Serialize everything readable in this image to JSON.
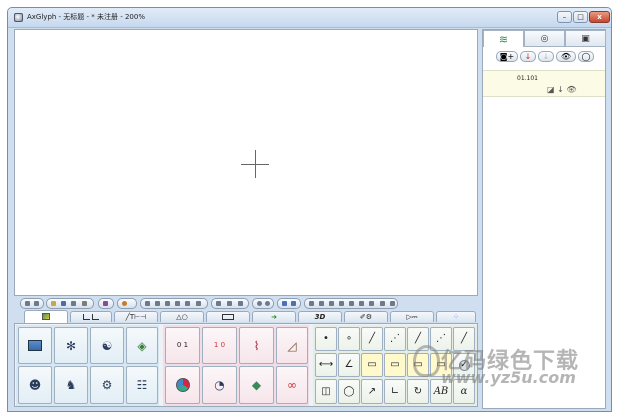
{
  "window": {
    "title": "AxGlyph - 无标题 - * 未注册 - 200%",
    "controls": {
      "minimize": "–",
      "maximize": "□",
      "close": "x"
    }
  },
  "canvas": {
    "cursor": "crosshair"
  },
  "palette_tabs": [
    {
      "icon": "image-tab-icon",
      "label": ""
    },
    {
      "icon": "chart-tab-icon",
      "label": ""
    },
    {
      "icon": "text-tab-icon",
      "label": "╱T⊢⊣"
    },
    {
      "icon": "shape-tab-icon",
      "label": "△○"
    },
    {
      "icon": "connector-tab-icon",
      "label": ""
    },
    {
      "icon": "arrow-tab-icon",
      "label": "➜"
    },
    {
      "icon": "3d-tab-icon",
      "label": "3D"
    },
    {
      "icon": "pen-gear-tab-icon",
      "label": "✐⚙"
    },
    {
      "icon": "electrical-tab-icon",
      "label": "▷⎓"
    },
    {
      "icon": "dots-tab-icon",
      "label": "⁘"
    }
  ],
  "palette": {
    "group2_labels": {
      "fraction": "0 1",
      "vertical_fraction": "1 0"
    },
    "group3_text": {
      "ab": "AB",
      "alpha": "α"
    },
    "group3_glyphs": [
      "•",
      "∘",
      "╱",
      "⋰",
      "╱",
      "⋰",
      "⟷",
      "∠",
      "▭",
      "▭",
      "▭",
      "▭",
      "◫",
      "◯",
      "↗",
      "∟",
      "↻"
    ]
  },
  "right_panel": {
    "tabs": [
      {
        "icon": "layers-icon",
        "label": "≋"
      },
      {
        "icon": "properties-icon",
        "label": "◎"
      },
      {
        "icon": "camera-icon",
        "label": "▣"
      }
    ],
    "toolbar": [
      "◙+",
      "↓",
      "↓",
      "👁",
      "◯"
    ],
    "layer": {
      "name": "01.101",
      "icons": "◪ ↓ 👁"
    }
  },
  "watermark": {
    "text": "亿码绿色下载",
    "url": "www.yz5u.com"
  },
  "colors": {
    "title_gradient": "#c6d8ee",
    "group_blue": "#d8e8f2",
    "group_pink": "#f3dde4",
    "group_green": "#e6eee3",
    "layer_row": "#fbfbe6"
  }
}
